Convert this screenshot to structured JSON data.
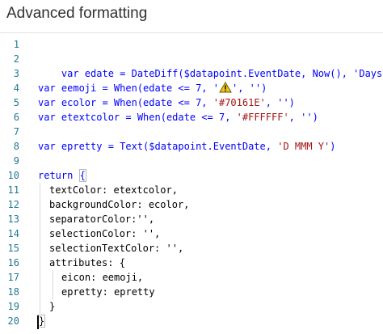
{
  "header": {
    "title": "Advanced formatting"
  },
  "editor": {
    "line_numbers": [
      "1",
      "2",
      "3",
      "4",
      "5",
      "6",
      "7",
      "8",
      "9",
      "10",
      "11",
      "12",
      "13",
      "14",
      "15",
      "16",
      "17",
      "18",
      "19",
      "20"
    ],
    "lines": {
      "l2": "var edate = DateDiff($datapoint.EventDate, Now(), 'Days')",
      "l4_a": "var eemoji = When(edate <= 7, '",
      "l4_b": "', '')",
      "l5_a": "var ecolor = When(edate <= 7, ",
      "l5_b": "'#70161E'",
      "l5_c": ", '')",
      "l6_a": "var etextcolor = When(edate <= 7, ",
      "l6_b": "'#FFFFFF'",
      "l6_c": ", '')",
      "l8_a": "var epretty = Text($datapoint.EventDate, ",
      "l8_b": "'D MMM Y'",
      "l8_c": ")",
      "l10_kw": "return",
      "l10_brace": "{",
      "l11": "textColor: etextcolor,",
      "l12": "backgroundColor: ecolor,",
      "l13": "separatorColor:'',",
      "l14": "selectionColor: '',",
      "l15": "selectionTextColor: '',",
      "l16": "attributes: {",
      "l17": "eicon: eemoji,",
      "l18": "epretty: epretty",
      "l19": "}",
      "l20": "}"
    },
    "emoji_icon": "warning-icon",
    "colors": {
      "line_number": "#237893",
      "keyword": "#0000ff",
      "string": "#a31515",
      "warning_fill": "#f2c811"
    }
  }
}
